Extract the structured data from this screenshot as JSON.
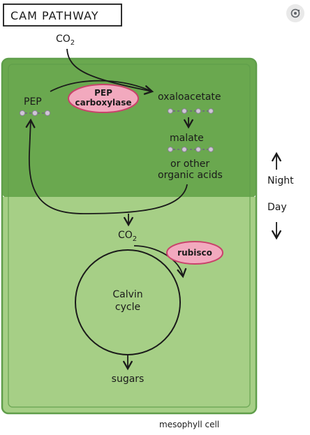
{
  "title": "CAM PATHWAY",
  "co2_top": {
    "base": "CO",
    "sub": "2"
  },
  "co2_mid": {
    "base": "CO",
    "sub": "2"
  },
  "pep": "PEP",
  "enzyme1": {
    "line1": "PEP",
    "line2": "carboxylase"
  },
  "oxaloacetate": "oxaloacetate",
  "malate": "malate",
  "other_acids": {
    "line1": "or other",
    "line2": "organic acids"
  },
  "night": "Night",
  "day": "Day",
  "enzyme2": "rubisco",
  "cycle": {
    "line1": "Calvin",
    "line2": "cycle"
  },
  "sugars": "sugars",
  "cell_label": "mesophyll cell",
  "colors": {
    "night_green": "#6aa84f",
    "day_green": "#a6cf86",
    "cell_border": "#5f9e4a",
    "enzyme_pink": "#f2a9be",
    "enzyme_border": "#c9426b",
    "molecule_dot": "#cfc6d6"
  },
  "icons": [
    "search-lens-icon"
  ]
}
